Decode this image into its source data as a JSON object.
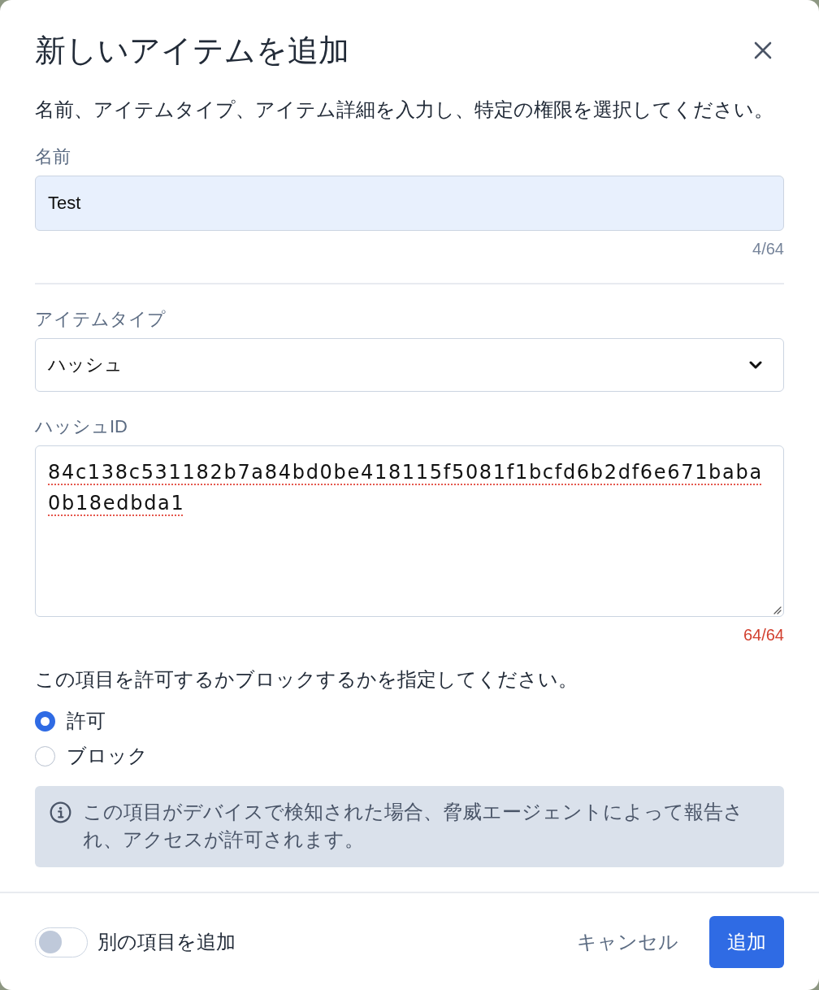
{
  "dialog": {
    "title": "新しいアイテムを追加",
    "description": "名前、アイテムタイプ、アイテム詳細を入力し、特定の権限を選択してください。"
  },
  "name_field": {
    "label": "名前",
    "value": "Test",
    "autofilled": true,
    "counter": "4/64",
    "limit_reached": false
  },
  "item_type": {
    "label": "アイテムタイプ",
    "value": "ハッシュ"
  },
  "hash_field": {
    "label": "ハッシュID",
    "value": "84c138c531182b7a84bd0be418115f5081f1bcfd6b2df6e671baba0b18edbda1",
    "misspelled": true,
    "counter": "64/64",
    "limit_reached": true
  },
  "permission": {
    "prompt": "この項目を許可するかブロックするかを指定してください。",
    "options": [
      {
        "label": "許可",
        "selected": true
      },
      {
        "label": "ブロック",
        "selected": false
      }
    ],
    "note": "この項目がデバイスで検知された場合、脅威エージェントによって報告され、アクセスが許可されます。"
  },
  "footer": {
    "add_another": {
      "label": "別の項目を追加",
      "on": false
    },
    "buttons": [
      {
        "label": "キャンセル",
        "kind": "secondary"
      },
      {
        "label": "追加",
        "kind": "primary"
      }
    ]
  }
}
